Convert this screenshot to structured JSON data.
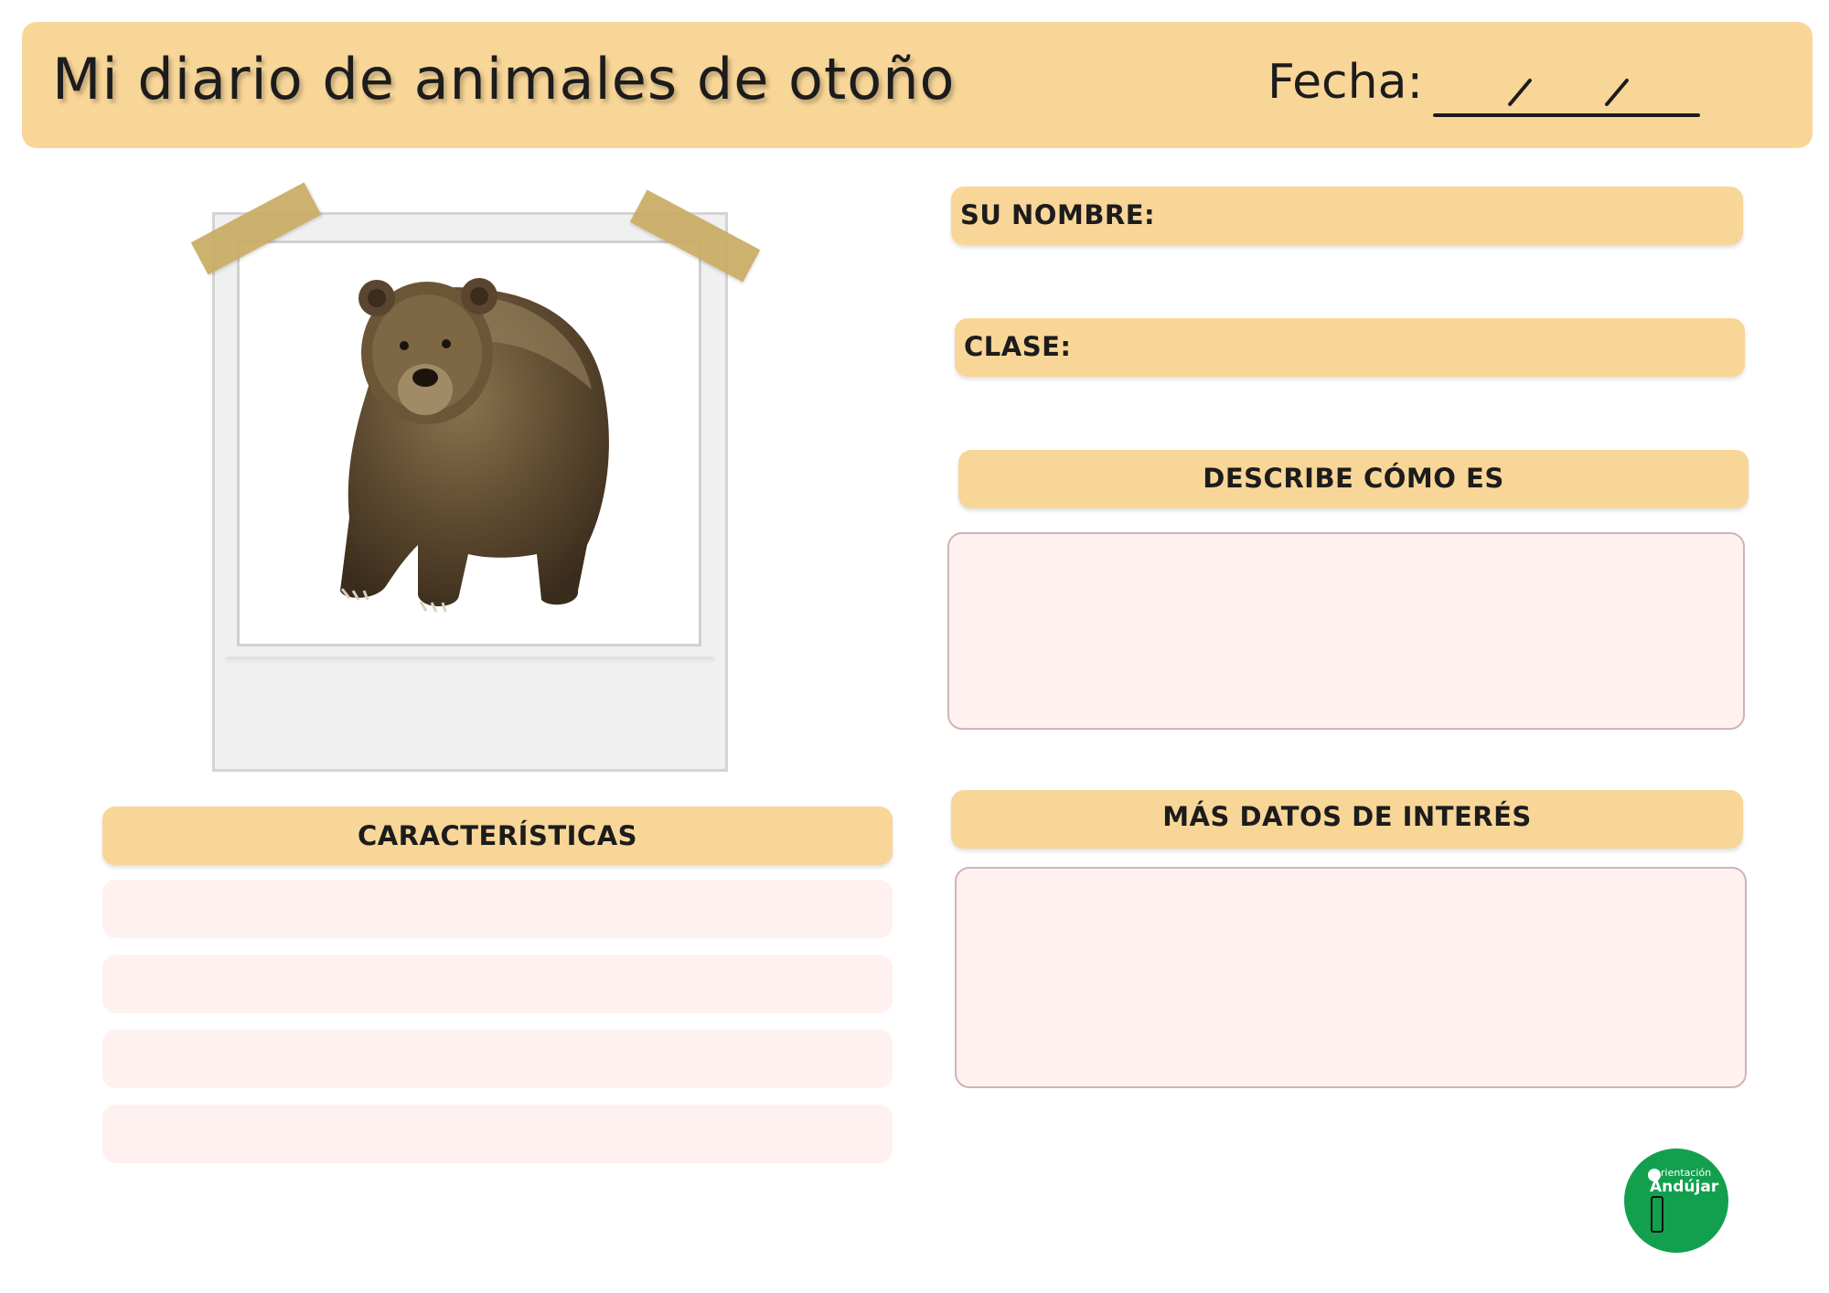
{
  "header": {
    "title": "Mi diario de animales de otoño",
    "date_label": "Fecha:"
  },
  "photo": {
    "subject": "brown-bear"
  },
  "fields": {
    "name_label": "SU NOMBRE:",
    "class_label": "CLASE:"
  },
  "sections": {
    "describe_label": "DESCRIBE CÓMO ES",
    "characteristics_label": "CARACTERÍSTICAS",
    "more_data_label": "MÁS DATOS DE INTERÉS"
  },
  "logo": {
    "small_text": "rientación",
    "big_text": "Andújar"
  },
  "colors": {
    "header_bg": "#f8d698",
    "pill_bg": "#f8d698",
    "row_bg": "#fff1ef",
    "logo_bg": "#12a04f"
  }
}
